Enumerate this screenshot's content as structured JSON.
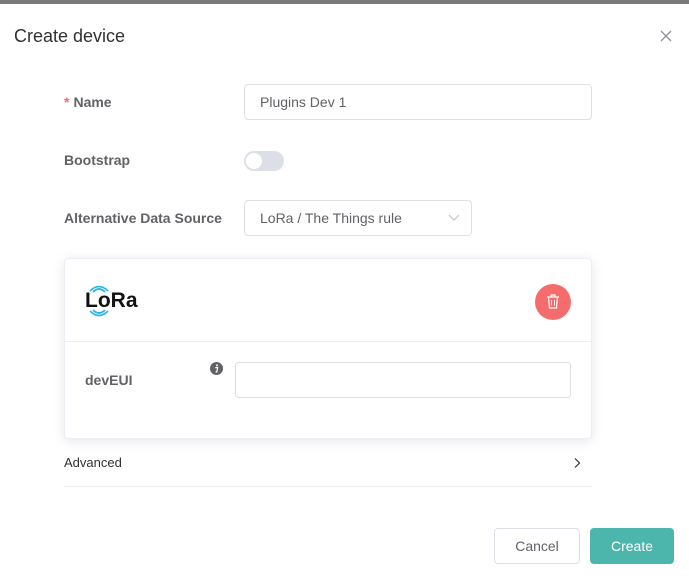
{
  "dialog": {
    "title": "Create device",
    "close_icon": "close-icon"
  },
  "form": {
    "name": {
      "label": "Name",
      "required_mark": "*",
      "value": "Plugins Dev 1"
    },
    "bootstrap": {
      "label": "Bootstrap",
      "enabled": false
    },
    "alt_source": {
      "label": "Alternative Data Source",
      "selected": "LoRa / The Things rule",
      "icon": "chevron-down-icon"
    }
  },
  "lora_card": {
    "logo_text": "LoRa",
    "logo_icon": "lora-logo",
    "delete_icon": "trash-icon",
    "dev_eui": {
      "label": "devEUI",
      "value": "",
      "info_icon": "info-icon"
    }
  },
  "advanced": {
    "label": "Advanced",
    "icon": "chevron-right-icon"
  },
  "footer": {
    "cancel_label": "Cancel",
    "create_label": "Create"
  },
  "colors": {
    "accent": "#4db6ac",
    "danger": "#f56c6c",
    "required": "#f56c6c",
    "switch_off": "#dcdfe6"
  }
}
